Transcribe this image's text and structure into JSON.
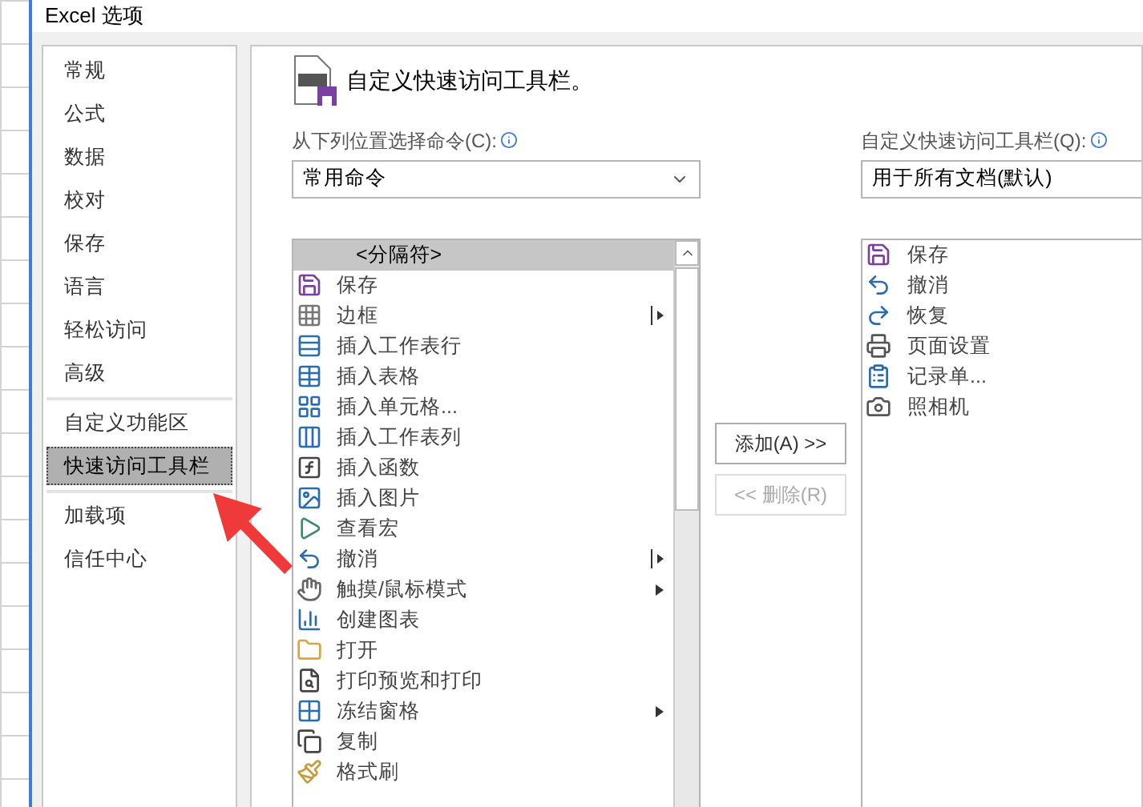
{
  "window": {
    "title": "Excel 选项"
  },
  "sidebar": {
    "items": [
      {
        "label": "常规",
        "selected": false,
        "separator_after": false
      },
      {
        "label": "公式",
        "selected": false,
        "separator_after": false
      },
      {
        "label": "数据",
        "selected": false,
        "separator_after": false
      },
      {
        "label": "校对",
        "selected": false,
        "separator_after": false
      },
      {
        "label": "保存",
        "selected": false,
        "separator_after": false
      },
      {
        "label": "语言",
        "selected": false,
        "separator_after": false
      },
      {
        "label": "轻松访问",
        "selected": false,
        "separator_after": false
      },
      {
        "label": "高级",
        "selected": false,
        "separator_after": true
      },
      {
        "label": "自定义功能区",
        "selected": false,
        "separator_after": false
      },
      {
        "label": "快速访问工具栏",
        "selected": true,
        "separator_after": true
      },
      {
        "label": "加载项",
        "selected": false,
        "separator_after": false
      },
      {
        "label": "信任中心",
        "selected": false,
        "separator_after": false
      }
    ]
  },
  "header": {
    "title": "自定义快速访问工具栏。"
  },
  "commands": {
    "label": "从下列位置选择命令(C):",
    "dropdown": "常用命令",
    "items": [
      {
        "label": "<分隔符>",
        "selected": true,
        "kind": "separator"
      },
      {
        "label": "保存",
        "selected": false,
        "kind": "plain"
      },
      {
        "label": "边框",
        "selected": false,
        "kind": "split"
      },
      {
        "label": "插入工作表行",
        "selected": false,
        "kind": "plain"
      },
      {
        "label": "插入表格",
        "selected": false,
        "kind": "plain"
      },
      {
        "label": "插入单元格...",
        "selected": false,
        "kind": "plain"
      },
      {
        "label": "插入工作表列",
        "selected": false,
        "kind": "plain"
      },
      {
        "label": "插入函数",
        "selected": false,
        "kind": "plain"
      },
      {
        "label": "插入图片",
        "selected": false,
        "kind": "plain"
      },
      {
        "label": "查看宏",
        "selected": false,
        "kind": "plain"
      },
      {
        "label": "撤消",
        "selected": false,
        "kind": "split"
      },
      {
        "label": "触摸/鼠标模式",
        "selected": false,
        "kind": "menu"
      },
      {
        "label": "创建图表",
        "selected": false,
        "kind": "plain"
      },
      {
        "label": "打开",
        "selected": false,
        "kind": "plain"
      },
      {
        "label": "打印预览和打印",
        "selected": false,
        "kind": "plain"
      },
      {
        "label": "冻结窗格",
        "selected": false,
        "kind": "menu"
      },
      {
        "label": "复制",
        "selected": false,
        "kind": "plain"
      },
      {
        "label": "格式刷",
        "selected": false,
        "kind": "plain"
      }
    ]
  },
  "buttons": [
    {
      "label": "添加(A) >>",
      "disabled": false
    },
    {
      "label": "<< 删除(R)",
      "disabled": true
    }
  ],
  "toolbar": {
    "label": "自定义快速访问工具栏(Q):",
    "dropdown": "用于所有文档(默认)",
    "items": [
      {
        "label": "保存",
        "selected": false
      },
      {
        "label": "撤消",
        "selected": false
      },
      {
        "label": "恢复",
        "selected": false
      },
      {
        "label": "页面设置",
        "selected": false
      },
      {
        "label": "记录单...",
        "selected": false
      },
      {
        "label": "照相机",
        "selected": false
      }
    ]
  }
}
